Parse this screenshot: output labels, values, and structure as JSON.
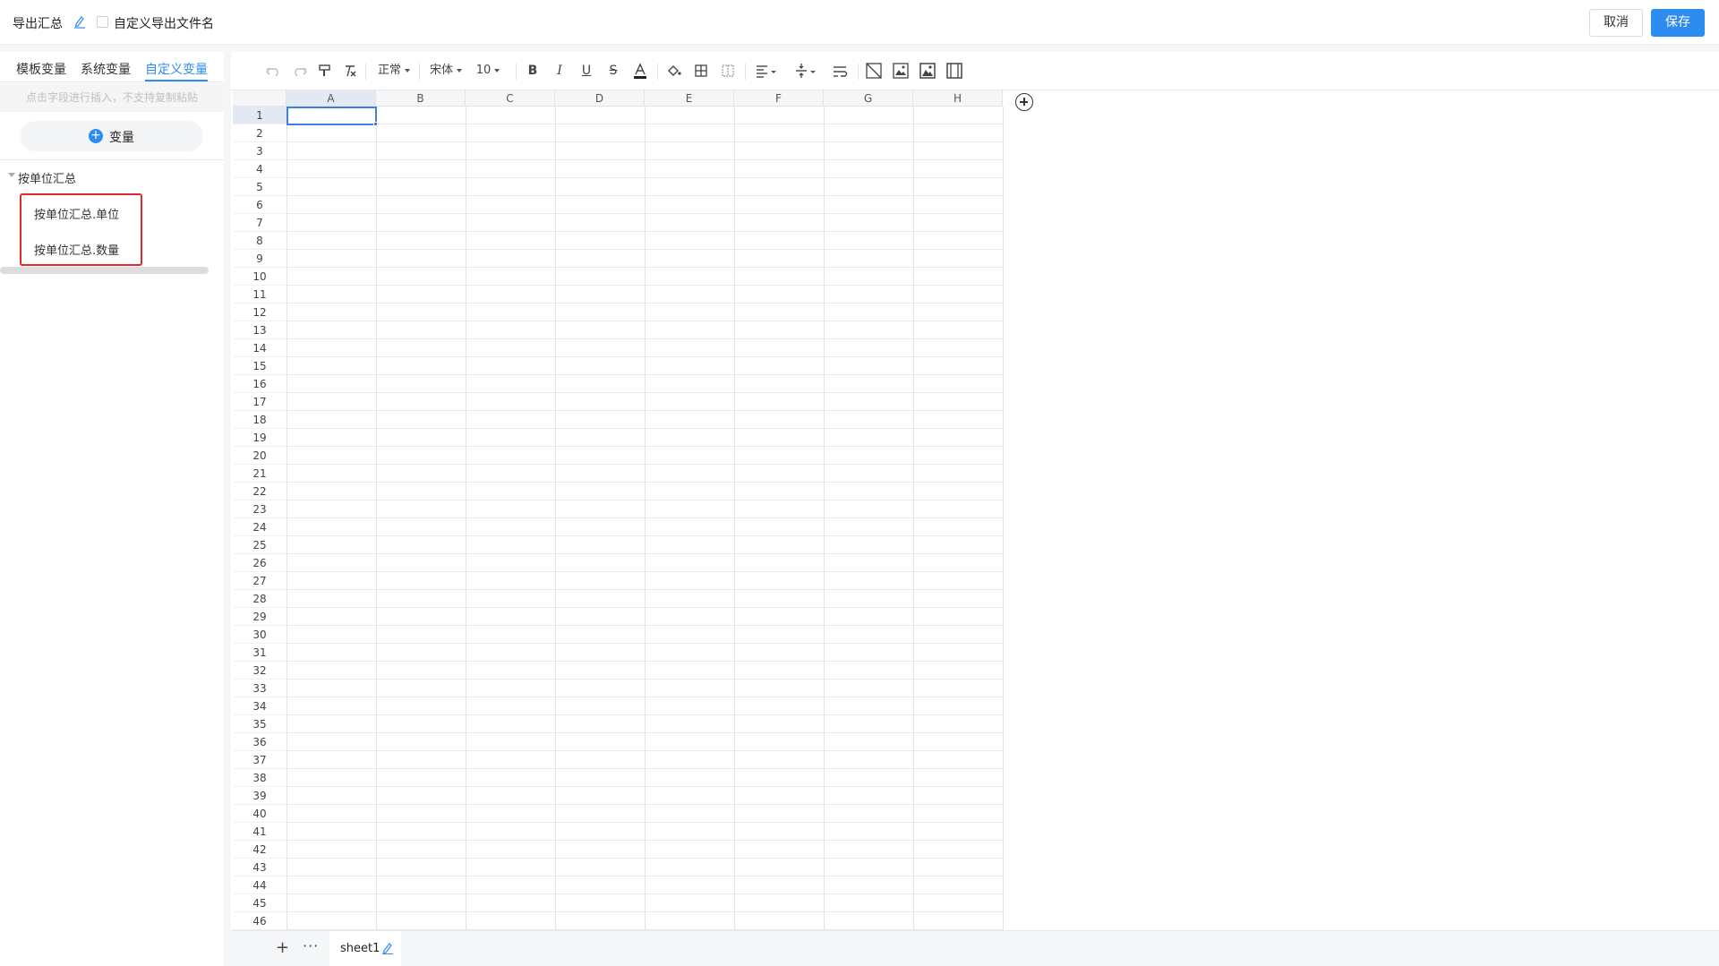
{
  "header": {
    "title": "导出汇总",
    "custom_filename_label": "自定义导出文件名",
    "cancel_label": "取消",
    "save_label": "保存"
  },
  "left_panel": {
    "tabs": [
      {
        "label": "模板变量"
      },
      {
        "label": "系统变量"
      },
      {
        "label": "自定义变量"
      }
    ],
    "active_tab": "自定义变量",
    "hint": "点击字段进行插入，不支持复制粘贴",
    "add_button_label": "变量",
    "tree": {
      "root": "按单位汇总",
      "items": [
        {
          "label": "按单位汇总.单位"
        },
        {
          "label": "按单位汇总.数量"
        }
      ]
    }
  },
  "toolbar": {
    "style_select": "正常",
    "font_select": "宋体",
    "size_select": "10"
  },
  "sheet": {
    "columns": [
      "A",
      "B",
      "C",
      "D",
      "E",
      "F",
      "G",
      "H"
    ],
    "row_count": 46,
    "active_cell": "A1"
  },
  "sheet_tabs": [
    {
      "name": "sheet1"
    }
  ],
  "colors": {
    "accent": "#2d8cf0",
    "highlight_box": "#e5262d"
  }
}
